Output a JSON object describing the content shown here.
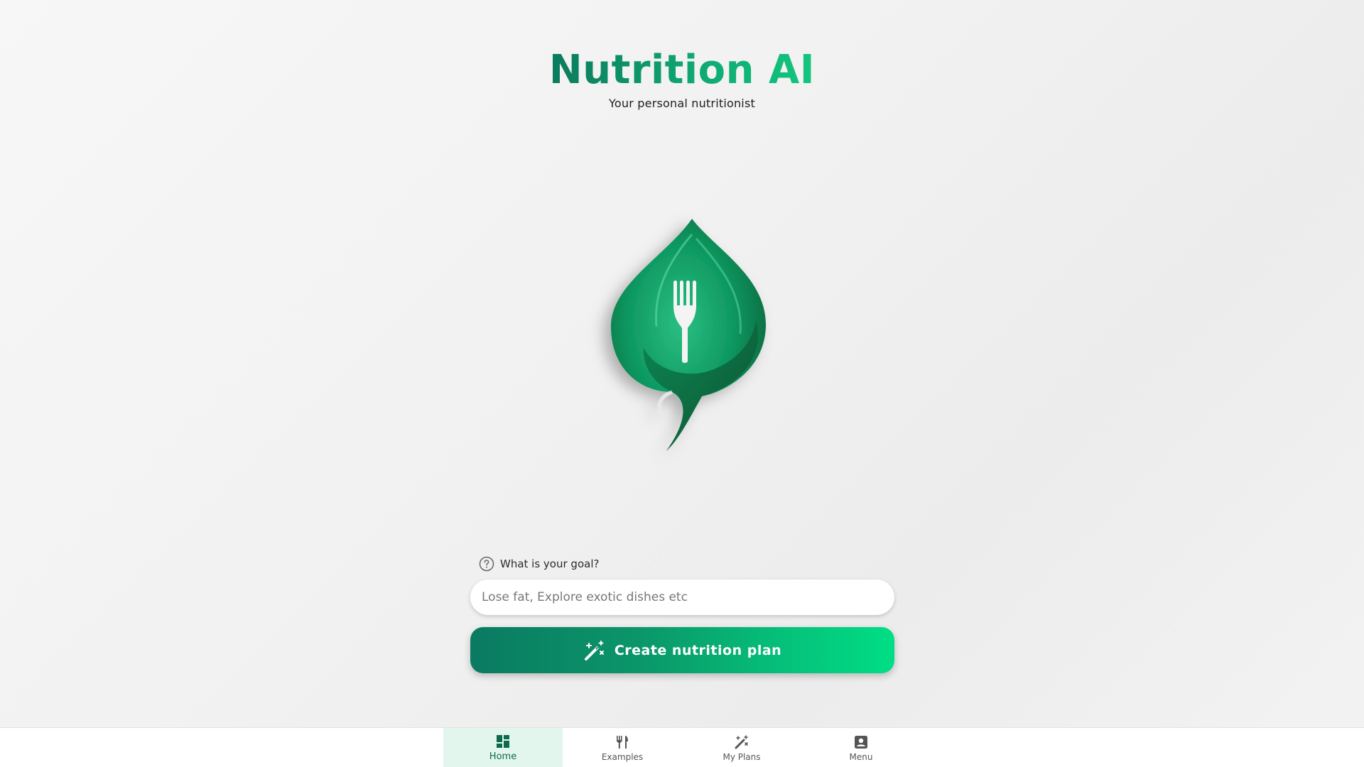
{
  "header": {
    "title": "Nutrition AI",
    "subtitle": "Your personal nutritionist"
  },
  "logo": {
    "icon": "leaf-fork-logo"
  },
  "goal": {
    "label": "What is your goal?",
    "icon": "help-circle-icon",
    "value": "",
    "placeholder": "Lose fat, Explore exotic dishes etc"
  },
  "create_button": {
    "label": "Create nutrition plan",
    "icon": "magic-wand-icon"
  },
  "colors": {
    "brand_dark": "#0a7a61",
    "brand_light": "#00de85",
    "nav_active_bg": "#e3f6ee"
  },
  "bottom_nav": {
    "items": [
      {
        "label": "Home",
        "icon": "dashboard-icon",
        "active": true
      },
      {
        "label": "Examples",
        "icon": "fork-knife-icon",
        "active": false
      },
      {
        "label": "My Plans",
        "icon": "magic-wand-icon",
        "active": false
      },
      {
        "label": "Menu",
        "icon": "account-box-icon",
        "active": false
      }
    ]
  }
}
